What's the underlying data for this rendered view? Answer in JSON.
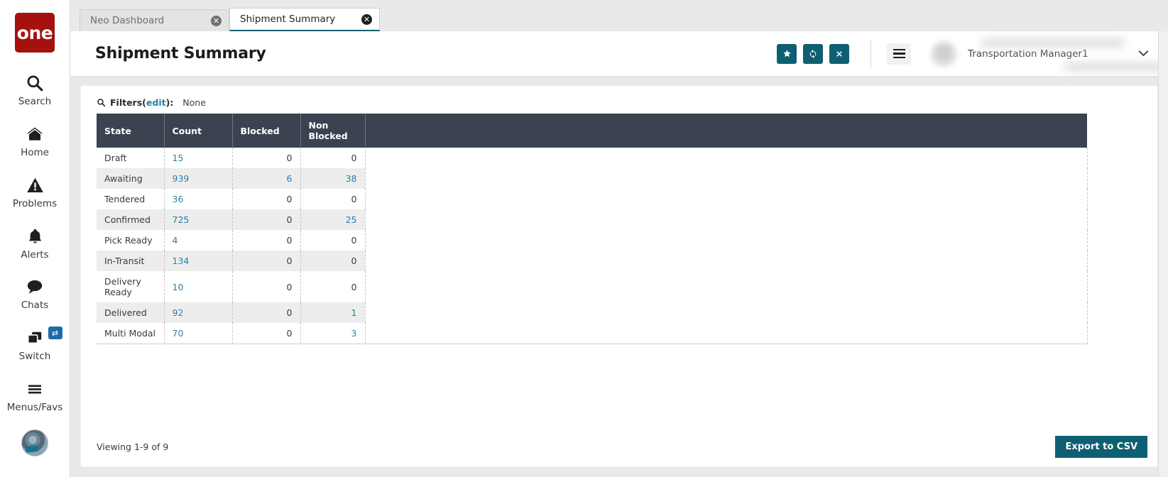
{
  "brand": {
    "logo_text": "one",
    "logo_color": "#a5110f"
  },
  "rail": {
    "items": [
      {
        "label": "Search",
        "icon": "search-icon"
      },
      {
        "label": "Home",
        "icon": "home-icon"
      },
      {
        "label": "Problems",
        "icon": "warning-icon"
      },
      {
        "label": "Alerts",
        "icon": "bell-icon"
      },
      {
        "label": "Chats",
        "icon": "chat-icon"
      },
      {
        "label": "Switch",
        "icon": "switch-icon",
        "badge": "⇄"
      },
      {
        "label": "Menus/Favs",
        "icon": "menu-icon"
      }
    ]
  },
  "tabs": [
    {
      "label": "Neo Dashboard",
      "active": false,
      "close": "✖"
    },
    {
      "label": "Shipment Summary",
      "active": true,
      "close": "✖"
    }
  ],
  "header": {
    "title": "Shipment Summary",
    "actions": [
      {
        "name": "favorite-button",
        "glyph": "★"
      },
      {
        "name": "refresh-button",
        "glyph": "⟳"
      },
      {
        "name": "close-button",
        "glyph": "✕"
      }
    ],
    "menu_button": "hamburger-icon",
    "user_name": "Transportation Manager1",
    "caret": "▼",
    "accent_color": "#0f5f72"
  },
  "filters": {
    "icon": "search-icon",
    "label": "Filters",
    "edit_label": "edit",
    "colon": ":",
    "open_paren": "(",
    "close_paren": ")",
    "value": "None"
  },
  "table": {
    "columns": [
      "State",
      "Count",
      "Blocked",
      "Non Blocked"
    ],
    "rows": [
      {
        "state": "Draft",
        "count": "15",
        "blocked": "0",
        "non_blocked": "0",
        "count_link": true,
        "blocked_link": false,
        "non_blocked_link": false
      },
      {
        "state": "Awaiting",
        "count": "939",
        "blocked": "6",
        "non_blocked": "38",
        "count_link": true,
        "blocked_link": true,
        "non_blocked_link": true
      },
      {
        "state": "Tendered",
        "count": "36",
        "blocked": "0",
        "non_blocked": "0",
        "count_link": true,
        "blocked_link": false,
        "non_blocked_link": false
      },
      {
        "state": "Confirmed",
        "count": "725",
        "blocked": "0",
        "non_blocked": "25",
        "count_link": true,
        "blocked_link": false,
        "non_blocked_link": true
      },
      {
        "state": "Pick Ready",
        "count": "4",
        "blocked": "0",
        "non_blocked": "0",
        "count_link": true,
        "blocked_link": false,
        "non_blocked_link": false
      },
      {
        "state": "In-Transit",
        "count": "134",
        "blocked": "0",
        "non_blocked": "0",
        "count_link": true,
        "blocked_link": false,
        "non_blocked_link": false
      },
      {
        "state": "Delivery Ready",
        "count": "10",
        "blocked": "0",
        "non_blocked": "0",
        "count_link": true,
        "blocked_link": false,
        "non_blocked_link": false
      },
      {
        "state": "Delivered",
        "count": "92",
        "blocked": "0",
        "non_blocked": "1",
        "count_link": true,
        "blocked_link": false,
        "non_blocked_link": true
      },
      {
        "state": "Multi Modal",
        "count": "70",
        "blocked": "0",
        "non_blocked": "3",
        "count_link": true,
        "blocked_link": false,
        "non_blocked_link": true
      }
    ]
  },
  "footer": {
    "viewing": "Viewing 1-9 of 9",
    "export_label": "Export to CSV"
  }
}
